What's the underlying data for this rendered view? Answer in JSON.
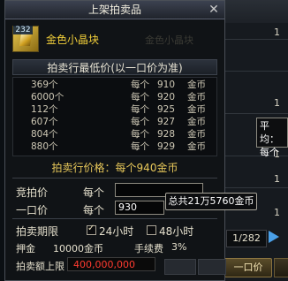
{
  "dialog": {
    "title": "上架拍卖品",
    "close_glyph": "✕",
    "item": {
      "name": "金色小晶块",
      "count": "232",
      "ghost_text": "金色小晶块"
    },
    "min_price_header": "拍卖行最低价(以一口价为准)",
    "price_list": [
      {
        "qty": "369个",
        "each": "每个",
        "value": "910",
        "unit": "金币"
      },
      {
        "qty": "6000个",
        "each": "每个",
        "value": "920",
        "unit": "金币"
      },
      {
        "qty": "112个",
        "each": "每个",
        "value": "925",
        "unit": "金币"
      },
      {
        "qty": "607个",
        "each": "每个",
        "value": "927",
        "unit": "金币"
      },
      {
        "qty": "804个",
        "each": "每个",
        "value": "928",
        "unit": "金币"
      },
      {
        "qty": "880个",
        "each": "每个",
        "value": "929",
        "unit": "金币"
      }
    ],
    "market_price": "拍卖行价格：每个940金币",
    "bid_label": "竞拍价",
    "bid_each": "每个",
    "bid_value": "",
    "buyout_label": "一口价",
    "buyout_each": "每个",
    "buyout_value": "930",
    "total_tip": "总共21万5760金币",
    "duration_label": "拍卖期限",
    "duration_24": "24小时",
    "duration_48": "48小时",
    "duration_24_checked": true,
    "duration_48_checked": false,
    "deposit_label": "押金",
    "deposit_value": "10000金币",
    "fee_label": "手续费",
    "fee_value": "3%",
    "cap_label": "拍卖额上限",
    "cap_value": "400,000,000"
  },
  "background": {
    "right_numbers": [
      "1",
      "1",
      "1",
      "1",
      "1"
    ],
    "right_tooltip_lines": [
      "平均：",
      "每个"
    ],
    "pager": "1/282",
    "buyout_button": "一口价"
  }
}
